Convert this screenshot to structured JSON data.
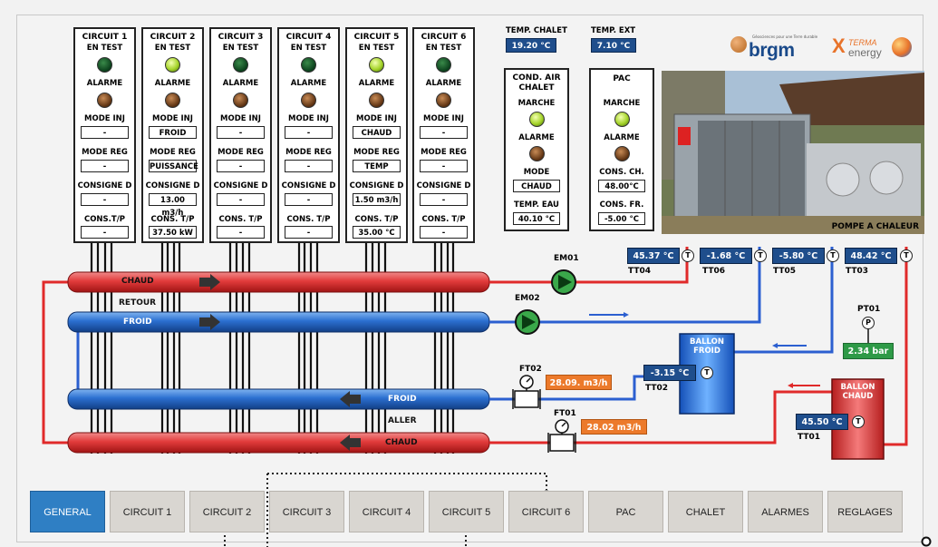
{
  "circuits": [
    {
      "title": "CIRCUIT 1",
      "test_label": "EN TEST",
      "alarm_label": "ALARME",
      "mode_inj_label": "MODE INJ",
      "mode_inj": "-",
      "mode_reg_label": "MODE REG",
      "mode_reg": "-",
      "consigne_label": "CONSIGNE D",
      "consigne": "-",
      "cons_tp_label": "CONS.T/P",
      "cons_tp": "-",
      "test_led": "off"
    },
    {
      "title": "CIRCUIT 2",
      "test_label": "EN TEST",
      "alarm_label": "ALARME",
      "mode_inj_label": "MODE INJ",
      "mode_inj": "FROID",
      "mode_reg_label": "MODE REG",
      "mode_reg": "PUISSANCE",
      "consigne_label": "CONSIGNE D",
      "consigne": "13.00 m3/h",
      "cons_tp_label": "CONS. T/P",
      "cons_tp": "37.50 kW",
      "test_led": "on"
    },
    {
      "title": "CIRCUIT 3",
      "test_label": "EN TEST",
      "alarm_label": "ALARME",
      "mode_inj_label": "MODE INJ",
      "mode_inj": "-",
      "mode_reg_label": "MODE REG",
      "mode_reg": "-",
      "consigne_label": "CONSIGNE D",
      "consigne": "-",
      "cons_tp_label": "CONS. T/P",
      "cons_tp": "-",
      "test_led": "off"
    },
    {
      "title": "CIRCUIT 4",
      "test_label": "EN TEST",
      "alarm_label": "ALARME",
      "mode_inj_label": "MODE INJ",
      "mode_inj": "-",
      "mode_reg_label": "MODE REG",
      "mode_reg": "-",
      "consigne_label": "CONSIGNE D",
      "consigne": "-",
      "cons_tp_label": "CONS. T/P",
      "cons_tp": "-",
      "test_led": "off"
    },
    {
      "title": "CIRCUIT 5",
      "test_label": "EN TEST",
      "alarm_label": "ALARME",
      "mode_inj_label": "MODE INJ",
      "mode_inj": "CHAUD",
      "mode_reg_label": "MODE REG",
      "mode_reg": "TEMP",
      "consigne_label": "CONSIGNE D",
      "consigne": "1.50 m3/h",
      "cons_tp_label": "CONS. T/P",
      "cons_tp": "35.00 °C",
      "test_led": "on"
    },
    {
      "title": "CIRCUIT 6",
      "test_label": "EN TEST",
      "alarm_label": "ALARME",
      "mode_inj_label": "MODE INJ",
      "mode_inj": "-",
      "mode_reg_label": "MODE REG",
      "mode_reg": "-",
      "consigne_label": "CONSIGNE D",
      "consigne": "-",
      "cons_tp_label": "CONS. T/P",
      "cons_tp": "-",
      "test_led": "off"
    }
  ],
  "temps": {
    "chalet_label": "TEMP. CHALET",
    "chalet_value": "19.20 °C",
    "ext_label": "TEMP. EXT",
    "ext_value": "7.10 °C"
  },
  "cond_air": {
    "title": "COND. AIR CHALET",
    "marche_label": "MARCHE",
    "alarme_label": "ALARME",
    "mode_label": "MODE",
    "mode_value": "CHAUD",
    "temp_eau_label": "TEMP. EAU",
    "temp_eau_value": "40.10 °C"
  },
  "pac": {
    "title": "PAC",
    "marche_label": "MARCHE",
    "alarme_label": "ALARME",
    "cons_ch_label": "CONS. CH.",
    "cons_ch_value": "48.00°C",
    "cons_fr_label": "CONS. FR.",
    "cons_fr_value": "-5.00 °C"
  },
  "logos": {
    "brgm": "brgm",
    "brgm_tagline": "Géosciences pour une Terre durable",
    "terma_x": "X",
    "terma_top": "TERMA",
    "terma_bottom": "energy"
  },
  "photo_caption": "POMPE A CHALEUR",
  "sensors": {
    "tt04": {
      "value": "45.37 °C",
      "label": "TT04"
    },
    "tt06": {
      "value": "-1.68 °C",
      "label": "TT06"
    },
    "tt05": {
      "value": "-5.80 °C",
      "label": "TT05"
    },
    "tt03": {
      "value": "48.42 °C",
      "label": "TT03"
    },
    "tt02": {
      "value": "-3.15 °C",
      "label": "TT02"
    },
    "tt01": {
      "value": "45.50 °C",
      "label": "TT01"
    },
    "sensor_symbol": "T",
    "pressure_symbol": "P"
  },
  "pressure": {
    "label": "PT01",
    "value": "2.34 bar"
  },
  "pumps": {
    "em01": "EM01",
    "em02": "EM02"
  },
  "flows": {
    "ft01": {
      "label": "FT01",
      "value": "28.02 m3/h"
    },
    "ft02": {
      "label": "FT02",
      "value": "28.09. m3/h"
    }
  },
  "tanks": {
    "froid": "BALLON FROID",
    "chaud": "BALLON CHAUD"
  },
  "pipes": {
    "retour_label": "RETOUR",
    "aller_label": "ALLER",
    "chaud_top": "CHAUD",
    "froid_top": "FROID",
    "froid_bottom": "FROID",
    "chaud_bottom": "CHAUD"
  },
  "nav": [
    "GENERAL",
    "CIRCUIT 1",
    "CIRCUIT 2",
    "CIRCUIT 3",
    "CIRCUIT 4",
    "CIRCUIT 5",
    "CIRCUIT 6",
    "PAC",
    "CHALET",
    "ALARMES",
    "REGLAGES"
  ],
  "nav_active": "GENERAL",
  "colors": {
    "hot": "#e23b3b",
    "cold": "#2b6fd0",
    "accent": "#2f7fc4",
    "value_box": "#1f4e8c",
    "flow_box": "#ec7a2b",
    "pressure_box": "#2e9a47"
  }
}
